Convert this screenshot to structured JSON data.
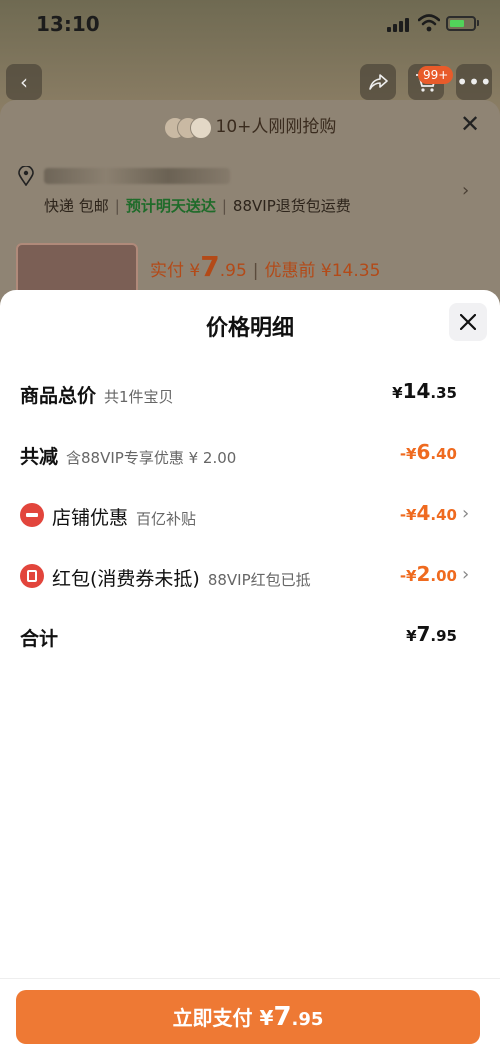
{
  "status": {
    "time": "13:10"
  },
  "background": {
    "cart_badge": "99+",
    "rush_text": "10+人刚刚抢购",
    "shipping": {
      "method": "快递 包邮",
      "eta": "预计明天送达",
      "return_note": "88VIP退货包运费"
    },
    "price": {
      "paid_label": "实付 ¥",
      "paid_int": "7",
      "paid_dec": ".95",
      "before_discount": "优惠前 ¥14.35"
    }
  },
  "modal": {
    "title": "价格明细",
    "rows": [
      {
        "label": "商品总价",
        "sub": "共1件宝贝",
        "currency": "¥",
        "int": "14",
        "dec": ".35"
      },
      {
        "label": "共减",
        "sub": "含88VIP专享优惠 ¥ 2.00",
        "currency": "-¥",
        "int": "6",
        "dec": ".40"
      },
      {
        "label": "店铺优惠",
        "sub": "百亿补贴",
        "currency": "-¥",
        "int": "4",
        "dec": ".40",
        "icon": "shop-coupon-icon"
      },
      {
        "label": "红包(消费券未抵)",
        "sub": "88VIP红包已抵",
        "currency": "-¥",
        "int": "2",
        "dec": ".00",
        "icon": "red-packet-icon"
      },
      {
        "label": "合计",
        "sub": "",
        "currency": "¥",
        "int": "7",
        "dec": ".95"
      }
    ],
    "pay_button": {
      "label": "立即支付 ¥",
      "int": "7",
      "dec": ".95"
    }
  },
  "colors": {
    "accent_orange": "#ef6a1f",
    "pay_button": "#ee7934",
    "icon_red": "#e2453c"
  }
}
